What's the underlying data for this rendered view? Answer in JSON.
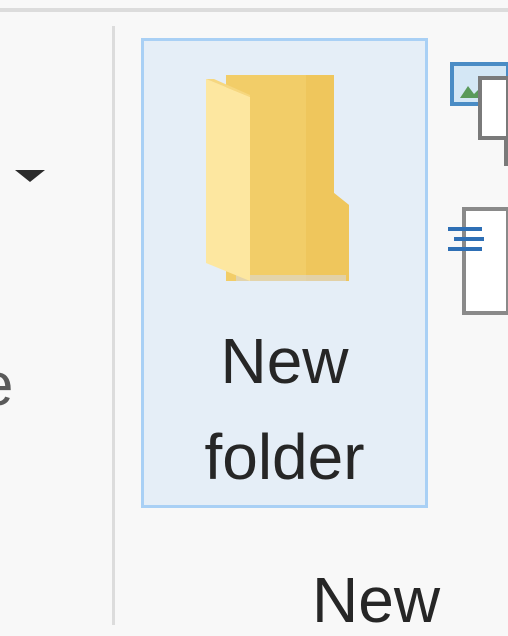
{
  "ribbon": {
    "left_group": {
      "dropdown_icon": "chevron-down-icon",
      "cut_off_label": "e"
    },
    "new_group": {
      "new_folder_button": {
        "icon": "folder-icon",
        "label_line1": "New",
        "label_line2": "folder",
        "selected": true
      },
      "new_item_icon": "new-item-icon",
      "easy_access_icon": "easy-access-icon",
      "group_label": "New"
    }
  },
  "colors": {
    "ribbon_background": "#f8f8f8",
    "button_hover_fill": "#e5eef7",
    "button_hover_border": "#a9d0f5",
    "folder_yellow": "#f3cd67",
    "text": "#262626"
  }
}
